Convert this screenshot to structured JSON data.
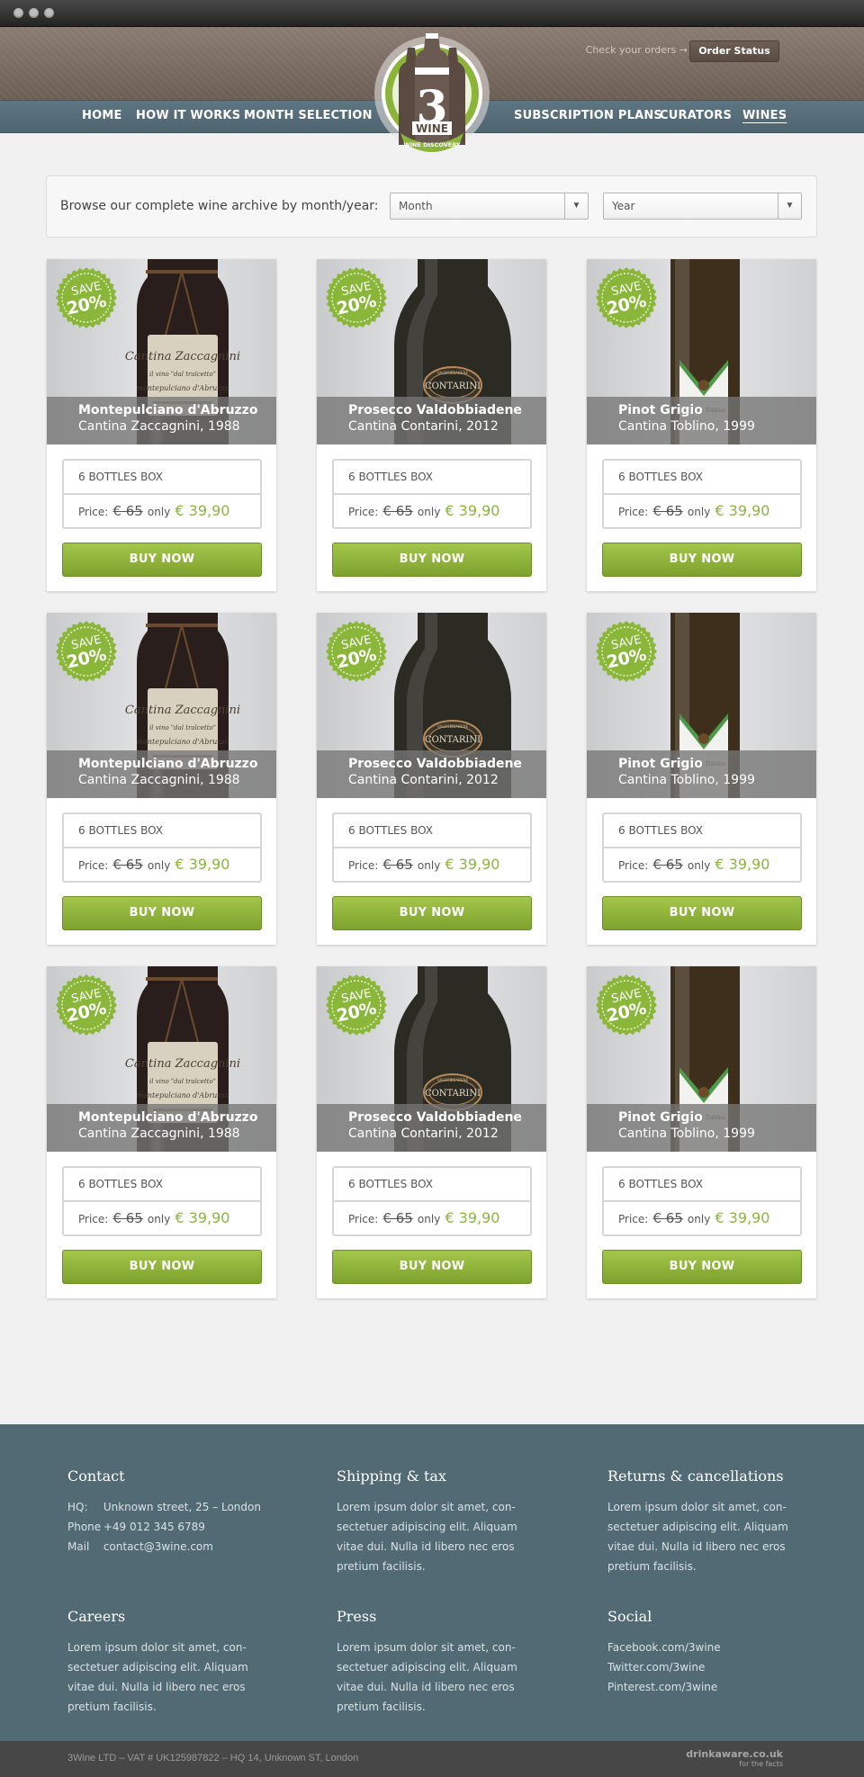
{
  "header": {
    "orders_hint": "Check your orders →",
    "order_status_label": "Order Status",
    "nav": [
      {
        "label": "HOME"
      },
      {
        "label": "HOW IT WORKS"
      },
      {
        "label": "MONTH SELECTION"
      },
      {
        "label": "SUBSCRIPTION PLANS"
      },
      {
        "label": "CURATORS"
      },
      {
        "label": "WINES",
        "active": true
      }
    ],
    "logo": {
      "main": "3",
      "word": "WINE",
      "ribbon": "WINE DISCOVERY"
    }
  },
  "filter": {
    "label": "Browse our complete wine archive by month/year:",
    "month": {
      "value": "Month"
    },
    "year": {
      "value": "Year"
    }
  },
  "products": [
    {
      "name": "Montepulciano d'Abruzzo",
      "producer": "Cantina Zaccagnini, 1988",
      "bottle": "zaccagnini",
      "save": "SAVE",
      "discount": "20%",
      "box": "6 BOTTLES BOX",
      "price_label": "Price:",
      "old_price": "€ 65",
      "only": "only",
      "new_price": "€ 39,90",
      "buy": "BUY NOW"
    },
    {
      "name": "Prosecco Valdobbiadene",
      "producer": "Cantina Contarini, 2012",
      "bottle": "contarini",
      "save": "SAVE",
      "discount": "20%",
      "box": "6 BOTTLES BOX",
      "price_label": "Price:",
      "old_price": "€ 65",
      "only": "only",
      "new_price": "€ 39,90",
      "buy": "BUY NOW"
    },
    {
      "name": "Pinot Grigio",
      "producer": "Cantina Toblino, 1999",
      "bottle": "toblino",
      "save": "SAVE",
      "discount": "20%",
      "box": "6 BOTTLES BOX",
      "price_label": "Price:",
      "old_price": "€ 65",
      "only": "only",
      "new_price": "€ 39,90",
      "buy": "BUY NOW"
    },
    {
      "name": "Montepulciano d'Abruzzo",
      "producer": "Cantina Zaccagnini, 1988",
      "bottle": "zaccagnini",
      "save": "SAVE",
      "discount": "20%",
      "box": "6 BOTTLES BOX",
      "price_label": "Price:",
      "old_price": "€ 65",
      "only": "only",
      "new_price": "€ 39,90",
      "buy": "BUY NOW"
    },
    {
      "name": "Prosecco Valdobbiadene",
      "producer": "Cantina Contarini, 2012",
      "bottle": "contarini",
      "save": "SAVE",
      "discount": "20%",
      "box": "6 BOTTLES BOX",
      "price_label": "Price:",
      "old_price": "€ 65",
      "only": "only",
      "new_price": "€ 39,90",
      "buy": "BUY NOW"
    },
    {
      "name": "Pinot Grigio",
      "producer": "Cantina Toblino, 1999",
      "bottle": "toblino",
      "save": "SAVE",
      "discount": "20%",
      "box": "6 BOTTLES BOX",
      "price_label": "Price:",
      "old_price": "€ 65",
      "only": "only",
      "new_price": "€ 39,90",
      "buy": "BUY NOW"
    },
    {
      "name": "Montepulciano d'Abruzzo",
      "producer": "Cantina Zaccagnini, 1988",
      "bottle": "zaccagnini",
      "save": "SAVE",
      "discount": "20%",
      "box": "6 BOTTLES BOX",
      "price_label": "Price:",
      "old_price": "€ 65",
      "only": "only",
      "new_price": "€ 39,90",
      "buy": "BUY NOW"
    },
    {
      "name": "Prosecco Valdobbiadene",
      "producer": "Cantina Contarini, 2012",
      "bottle": "contarini",
      "save": "SAVE",
      "discount": "20%",
      "box": "6 BOTTLES BOX",
      "price_label": "Price:",
      "old_price": "€ 65",
      "only": "only",
      "new_price": "€ 39,90",
      "buy": "BUY NOW"
    },
    {
      "name": "Pinot Grigio",
      "producer": "Cantina Toblino, 1999",
      "bottle": "toblino",
      "save": "SAVE",
      "discount": "20%",
      "box": "6 BOTTLES BOX",
      "price_label": "Price:",
      "old_price": "€ 65",
      "only": "only",
      "new_price": "€ 39,90",
      "buy": "BUY NOW"
    }
  ],
  "footer": {
    "contact": {
      "title": "Contact",
      "hq_label": "HQ:",
      "hq": "Unknown street, 25 – London",
      "phone_label": "Phone",
      "phone": "+49 012 345 6789",
      "mail_label": "Mail",
      "mail": "contact@3wine.com"
    },
    "shipping": {
      "title": "Shipping & tax",
      "text": "Lorem ipsum dolor sit amet, con- sectetuer adipiscing elit. Aliquam vitae dui. Nulla id libero nec eros pretium facilisis."
    },
    "returns": {
      "title": "Returns & cancellations",
      "text": "Lorem ipsum dolor sit amet, con- sectetuer adipiscing elit. Aliquam vitae dui. Nulla id libero nec eros pretium facilisis."
    },
    "careers": {
      "title": "Careers",
      "text": "Lorem ipsum dolor sit amet, con- sectetuer adipiscing elit. Aliquam vitae dui. Nulla id libero nec eros pretium facilisis."
    },
    "press": {
      "title": "Press",
      "text": "Lorem ipsum dolor sit amet, con- sectetuer adipiscing elit. Aliquam vitae dui. Nulla id libero nec eros pretium facilisis."
    },
    "social": {
      "title": "Social",
      "links": [
        "Facebook.com/3wine",
        "Twitter.com/3wine",
        "Pinterest.com/3wine"
      ]
    },
    "copyright": "3Wine LTD – VAT # UK125987822 – HQ 14, Unknown ST, London",
    "drinkaware": "drinkaware.co.uk",
    "drinkaware_sub": "for the facts"
  },
  "colors": {
    "accent_green": "#8ab63a",
    "nav_blue": "#526a74",
    "header_brown": "#7d6f65"
  }
}
